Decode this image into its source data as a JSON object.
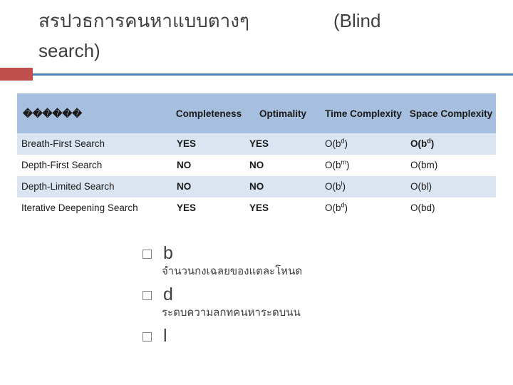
{
  "slide": {
    "title_line1": "สรปวธการคนหาแบบตางๆ",
    "title_line1_right": "(Blind",
    "title_line2": "search)"
  },
  "table": {
    "headers": {
      "name": "������",
      "completeness": "Completeness",
      "optimality": "Optimality",
      "time": "Time Complexity",
      "space": "Space Complexity"
    },
    "rows": [
      {
        "name": "Breath-First Search",
        "completeness": "YES",
        "optimality": "YES",
        "time_base": "O(b",
        "time_sup": "d",
        "time_tail": ")",
        "space_base": "O(b",
        "space_sup": "d",
        "space_tail": ")",
        "space_red": true
      },
      {
        "name": "Depth-First Search",
        "completeness": "NO",
        "optimality": "NO",
        "time_base": "O(b",
        "time_sup": "m",
        "time_tail": ")",
        "space_base": "O(bm)",
        "space_sup": "",
        "space_tail": "",
        "space_red": false
      },
      {
        "name": "Depth-Limited Search",
        "completeness": "NO",
        "optimality": "NO",
        "time_base": "O(b",
        "time_sup": "l",
        "time_tail": ")",
        "space_base": "O(bl)",
        "space_sup": "",
        "space_tail": "",
        "space_red": false
      },
      {
        "name": "Iterative Deepening Search",
        "completeness": "YES",
        "optimality": "YES",
        "time_base": "O(b",
        "time_sup": "d",
        "time_tail": ")",
        "space_base": "O(bd)",
        "space_sup": "",
        "space_tail": "",
        "space_red": false
      }
    ]
  },
  "bullets": [
    {
      "main": "b",
      "sub": "จำนวนกงเฉลยของแตละโหนด"
    },
    {
      "main": "d",
      "sub": "ระดบความลกทคนหาระดบนน"
    },
    {
      "main": "l",
      "sub": ""
    }
  ]
}
